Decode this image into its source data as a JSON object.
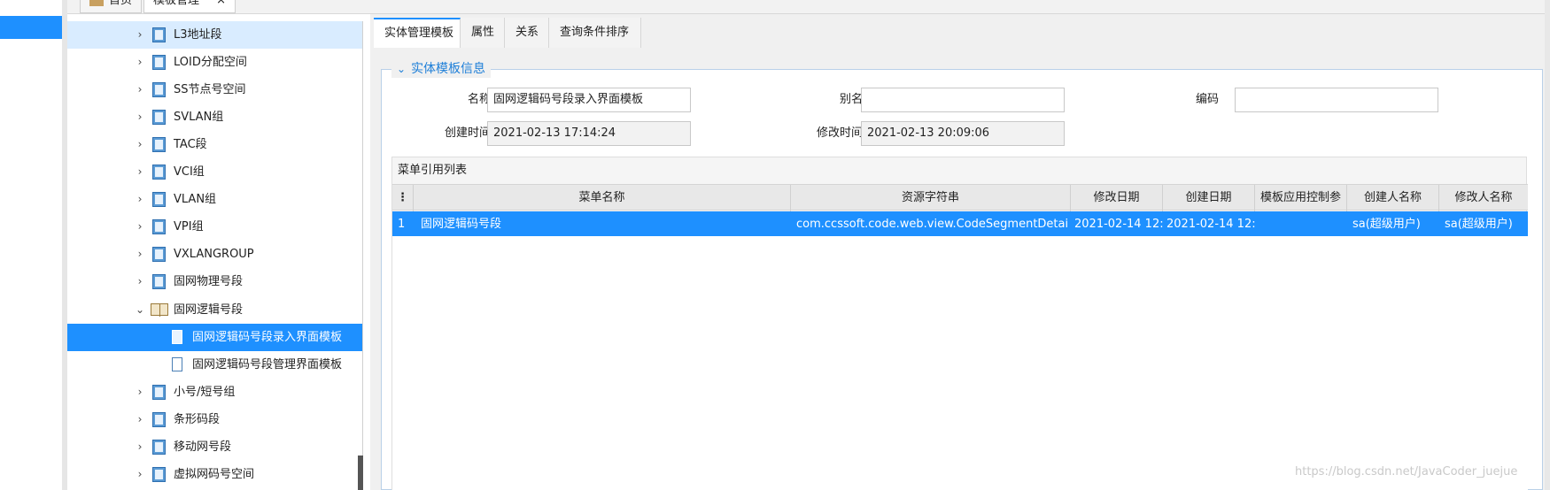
{
  "top_tabs": {
    "home_label": "首页",
    "template_mgmt_label": "模板管理",
    "close_glyph": "×"
  },
  "tree": {
    "items": [
      {
        "label": "L3地址段",
        "icon": "book-icon",
        "state": "highlight"
      },
      {
        "label": "LOID分配空间",
        "icon": "book-icon"
      },
      {
        "label": "SS节点号空间",
        "icon": "book-icon"
      },
      {
        "label": "SVLAN组",
        "icon": "book-icon"
      },
      {
        "label": "TAC段",
        "icon": "book-icon"
      },
      {
        "label": "VCI组",
        "icon": "book-icon"
      },
      {
        "label": "VLAN组",
        "icon": "book-icon"
      },
      {
        "label": "VPI组",
        "icon": "book-icon"
      },
      {
        "label": "VXLANGROUP",
        "icon": "book-icon"
      },
      {
        "label": "固网物理号段",
        "icon": "book-icon"
      },
      {
        "label": "固网逻辑号段",
        "icon": "open-book-icon",
        "expanded": true
      },
      {
        "label": "固网逻辑码号段录入界面模板",
        "icon": "document-icon",
        "leaf": true,
        "state": "selected"
      },
      {
        "label": "固网逻辑码号段管理界面模板",
        "icon": "document-icon",
        "leaf": true
      },
      {
        "label": "小号/短号组",
        "icon": "book-icon"
      },
      {
        "label": "条形码段",
        "icon": "book-icon"
      },
      {
        "label": "移动网号段",
        "icon": "book-icon"
      },
      {
        "label": "虚拟网码号空间",
        "icon": "book-icon"
      }
    ]
  },
  "sub_tabs": [
    "实体管理模板",
    "属性",
    "关系",
    "查询条件排序"
  ],
  "entity_info": {
    "legend": "实体模板信息",
    "name_label": "名称",
    "name_value": "固网逻辑码号段录入界面模板",
    "alias_label": "别名",
    "alias_value": "",
    "code_label": "编码",
    "code_value": "",
    "created_label": "创建时间",
    "created_value": "2021-02-13 17:14:24",
    "modified_label": "修改时间",
    "modified_value": "2021-02-13 20:09:06"
  },
  "menu_table": {
    "title": "菜单引用列表",
    "headers": [
      "菜单名称",
      "资源字符串",
      "修改日期",
      "创建日期",
      "模板应用控制参",
      "创建人名称",
      "修改人名称"
    ],
    "rows": [
      {
        "index": "1",
        "menu_name": "固网逻辑码号段",
        "resource": "com.ccssoft.code.web.view.CodeSegmentDetai",
        "modified": "2021-02-14 12:",
        "created": "2021-02-14 12:",
        "control": "",
        "creator": "sa(超级用户)",
        "modifier": "sa(超级用户)"
      }
    ]
  },
  "watermark": "https://blog.csdn.net/JavaCoder_juejue",
  "colors": {
    "accent": "#1e90ff",
    "legend_text": "#1e7fd8"
  }
}
